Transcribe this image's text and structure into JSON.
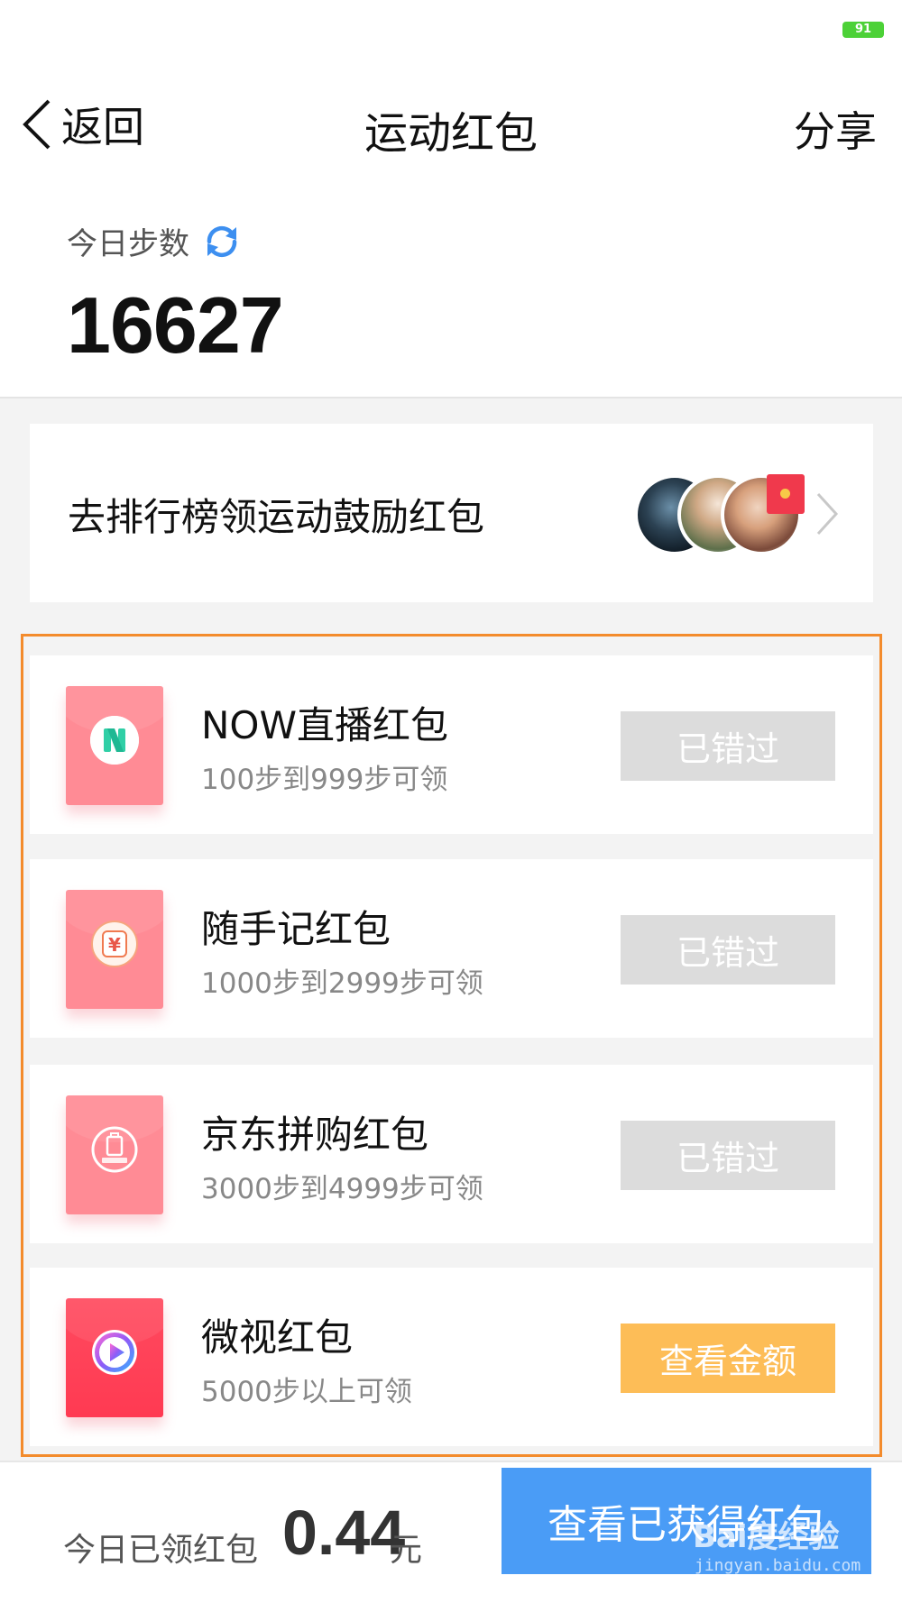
{
  "status_bar": {
    "battery": "91"
  },
  "nav": {
    "back_label": "返回",
    "title": "运动红包",
    "share_label": "分享"
  },
  "steps": {
    "label": "今日步数",
    "value": "16627"
  },
  "ranking": {
    "text": "去排行榜领运动鼓励红包"
  },
  "packets": [
    {
      "name": "NOW直播红包",
      "condition": "100步到999步可领",
      "button": "已错过",
      "state": "missed",
      "brand_icon": "now-live-logo-icon"
    },
    {
      "name": "随手记红包",
      "condition": "1000步到2999步可领",
      "button": "已错过",
      "state": "missed",
      "brand_icon": "yuan-logo-icon"
    },
    {
      "name": "京东拼购红包",
      "condition": "3000步到4999步可领",
      "button": "已错过",
      "state": "missed",
      "brand_icon": "jd-pingou-logo-icon"
    },
    {
      "name": "微视红包",
      "condition": "5000步以上可领",
      "button": "查看金额",
      "state": "active",
      "brand_icon": "weishi-play-logo-icon"
    }
  ],
  "bottom": {
    "today_label": "今日已领红包",
    "amount": "0.44",
    "unit": "元",
    "view_button": "查看已获得红包"
  },
  "watermark": {
    "text": "Bai度经验",
    "sub": "jingyan.baidu.com"
  },
  "colors": {
    "accent_blue": "#4a9cf6",
    "missed_gray": "#dcdcdc",
    "active_orange": "#fdbd57",
    "packet_pink": "#ff8b95",
    "frame_orange": "#f38b2c"
  }
}
